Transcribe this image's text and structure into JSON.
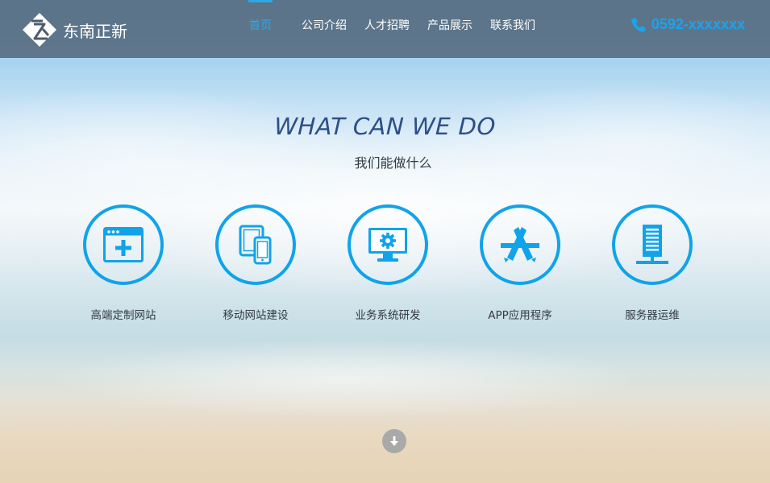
{
  "header": {
    "logo_text": "东南正新",
    "nav": [
      {
        "label": "首页",
        "active": true
      },
      {
        "label": "公司介绍",
        "active": false
      },
      {
        "label": "人才招聘",
        "active": false
      },
      {
        "label": "产品展示",
        "active": false
      },
      {
        "label": "联系我们",
        "active": false
      }
    ],
    "phone": "0592-xxxxxxx",
    "phone_icon": "phone-icon"
  },
  "main": {
    "headline": "WHAT CAN WE DO",
    "subhead": "我们能做什么",
    "services": [
      {
        "label": "高端定制网站",
        "icon": "browser-add-icon"
      },
      {
        "label": "移动网站建设",
        "icon": "tablet-phone-icon"
      },
      {
        "label": "业务系统研发",
        "icon": "monitor-gear-icon"
      },
      {
        "label": "APP应用程序",
        "icon": "app-store-icon"
      },
      {
        "label": "服务器运维",
        "icon": "server-icon"
      }
    ],
    "scroll_icon": "arrow-down-icon"
  },
  "colors": {
    "accent": "#10a3ea",
    "header_bg": "#4b5c6e",
    "headline": "#2d4f86"
  }
}
